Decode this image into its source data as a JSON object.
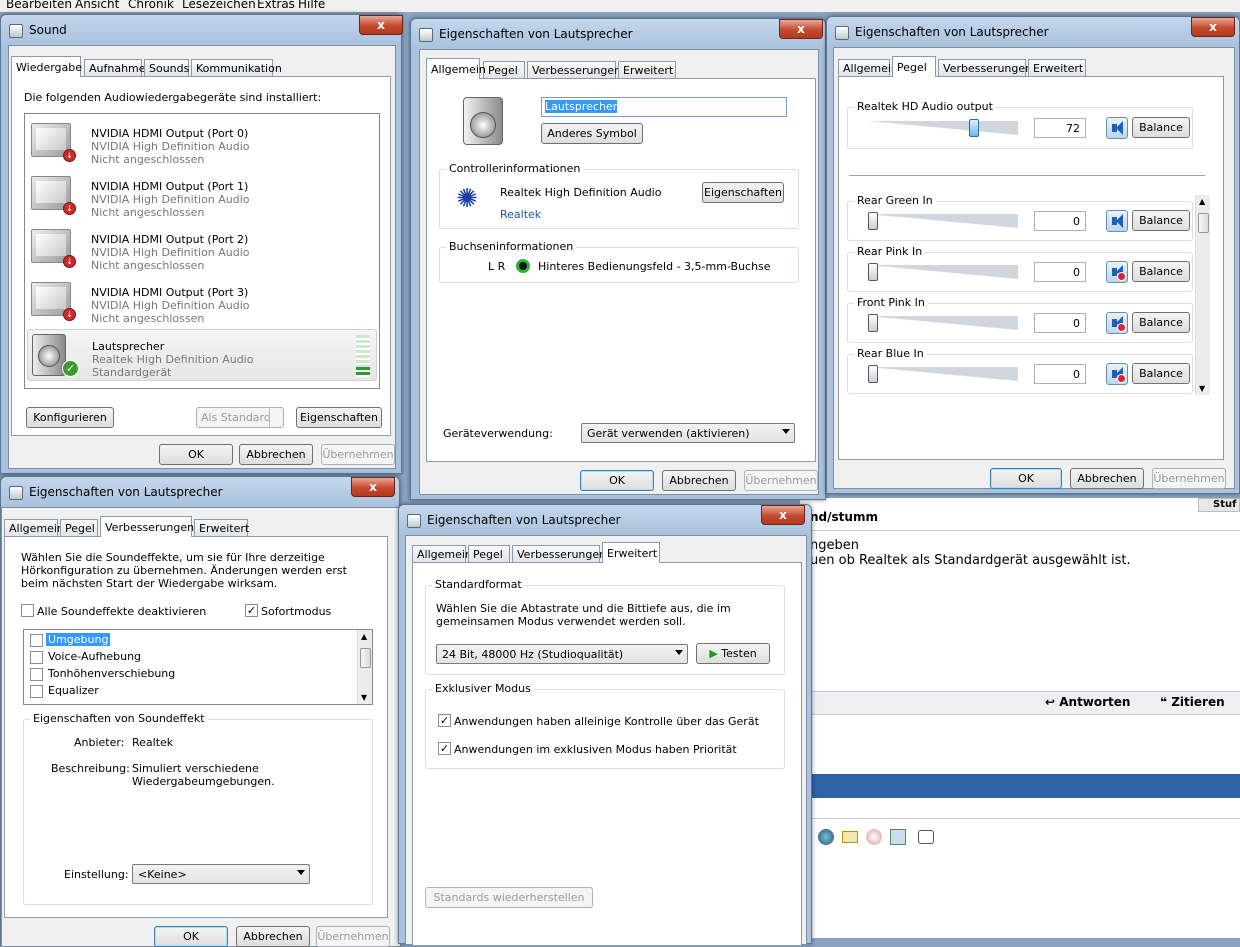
{
  "browser_menu": {
    "items": [
      "Bearbeiten",
      "Ansicht",
      "Chronik",
      "Lesezeichen",
      "Extras",
      "Hilfe"
    ]
  },
  "sound_window": {
    "title": "Sound",
    "close": "x",
    "tabs": [
      "Wiedergabe",
      "Aufnahme",
      "Sounds",
      "Kommunikation"
    ],
    "intro": "Die folgenden Audiowiedergabegeräte sind installiert:",
    "devices": [
      {
        "name": "NVIDIA HDMI Output (Port 0)",
        "driver": "NVIDIA High Definition Audio",
        "status": "Nicht angeschlossen"
      },
      {
        "name": "NVIDIA HDMI Output (Port 1)",
        "driver": "NVIDIA High Definition Audio",
        "status": "Nicht angeschlossen"
      },
      {
        "name": "NVIDIA HDMI Output (Port 2)",
        "driver": "NVIDIA High Definition Audio",
        "status": "Nicht angeschlossen"
      },
      {
        "name": "NVIDIA HDMI Output (Port 3)",
        "driver": "NVIDIA High Definition Audio",
        "status": "Nicht angeschlossen"
      },
      {
        "name": "Lautsprecher",
        "driver": "Realtek High Definition Audio",
        "status": "Standardgerät"
      }
    ],
    "configure": "Konfigurieren",
    "set_default": "Als Standard",
    "properties": "Eigenschaften",
    "ok": "OK",
    "cancel": "Abbrechen",
    "apply": "Übernehmen"
  },
  "general_window": {
    "title": "Eigenschaften von Lautsprecher",
    "close": "x",
    "tabs": [
      "Allgemein",
      "Pegel",
      "Verbesserungen",
      "Erweitert"
    ],
    "name_value": "Lautsprecher",
    "change_icon": "Anderes Symbol",
    "controller_label": "Controllerinformationen",
    "controller_name": "Realtek High Definition Audio",
    "controller_vendor": "Realtek",
    "controller_props": "Eigenschaften",
    "jack_label": "Buchseninformationen",
    "jack_lr": "L R",
    "jack_desc": "Hinteres Bedienungsfeld - 3,5-mm-Buchse",
    "usage_label": "Geräteverwendung:",
    "usage_value": "Gerät verwenden (aktivieren)",
    "ok": "OK",
    "cancel": "Abbrechen",
    "apply": "Übernehmen"
  },
  "levels_window": {
    "title": "Eigenschaften von Lautsprecher",
    "close": "x",
    "tabs": [
      "Allgemein",
      "Pegel",
      "Verbesserungen",
      "Erweitert"
    ],
    "main": {
      "label": "Realtek HD Audio output",
      "value": "72",
      "level": 0.72,
      "balance": "Balance"
    },
    "channels": [
      {
        "label": "Rear Green In",
        "value": "0",
        "balance": "Balance",
        "muted": false
      },
      {
        "label": "Rear Pink In",
        "value": "0",
        "balance": "Balance",
        "muted": true
      },
      {
        "label": "Front Pink In",
        "value": "0",
        "balance": "Balance",
        "muted": true
      },
      {
        "label": "Rear Blue In",
        "value": "0",
        "balance": "Balance",
        "muted": true
      }
    ],
    "ok": "OK",
    "cancel": "Abbrechen",
    "apply": "Übernehmen"
  },
  "enh_window": {
    "title": "Eigenschaften von Lautsprecher",
    "close": "x",
    "tabs": [
      "Allgemein",
      "Pegel",
      "Verbesserungen",
      "Erweitert"
    ],
    "desc": "Wählen Sie die Soundeffekte, um sie für Ihre derzeitige Hörkonfiguration zu übernehmen. Änderungen werden erst beim nächsten Start der Wiedergabe wirksam.",
    "disable_all": "Alle Soundeffekte deaktivieren",
    "immediate": "Sofortmodus",
    "effects": [
      "Umgebung",
      "Voice-Aufhebung",
      "Tonhöhenverschiebung",
      "Equalizer"
    ],
    "props_label": "Eigenschaften von Soundeffekt",
    "provider_label": "Anbieter:",
    "provider_value": "Realtek",
    "description_label": "Beschreibung:",
    "description_value": "Simuliert verschiedene Wiedergabeumgebungen.",
    "setting_label": "Einstellung:",
    "setting_value": "<Keine>",
    "ok": "OK",
    "cancel": "Abbrechen",
    "apply": "Übernehmen"
  },
  "adv_window": {
    "title": "Eigenschaften von Lautsprecher",
    "close": "x",
    "tabs": [
      "Allgemein",
      "Pegel",
      "Verbesserungen",
      "Erweitert"
    ],
    "std_label": "Standardformat",
    "std_desc": "Wählen Sie die Abtastrate und die Bittiefe aus, die im gemeinsamen Modus verwendet werden soll.",
    "format_value": "24 Bit, 48000 Hz (Studioqualität)",
    "test": "Testen",
    "excl_label": "Exklusiver Modus",
    "excl_1": "Anwendungen haben alleinige Kontrolle über das Gerät",
    "excl_2": "Anwendungen im exklusiven Modus haben Priorität",
    "restore": "Standards wiederherstellen"
  },
  "browser": {
    "heading": "nd/stumm",
    "line1": "ngeben",
    "line2": "uen ob Realtek als Standardgerät ausgewählt ist.",
    "reply": "Antworten",
    "quote": "Zitieren",
    "right_corner": "Stuf"
  }
}
